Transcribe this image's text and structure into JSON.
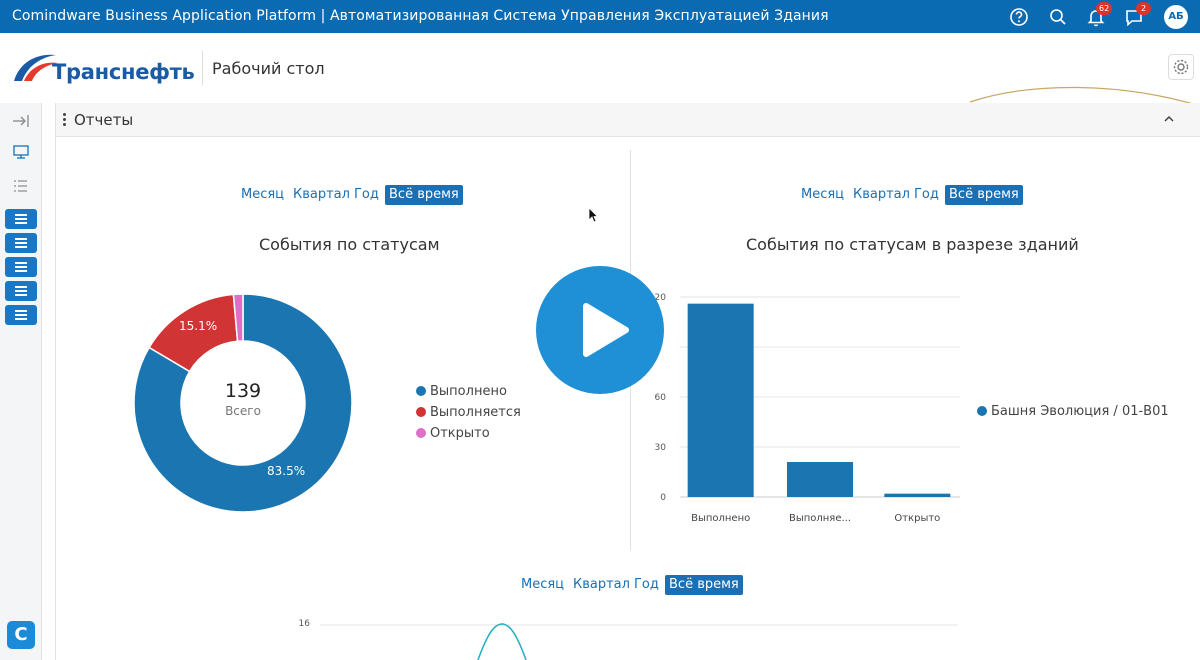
{
  "topbar": {
    "title": "Comindware Business Application Platform | Автоматизированная Система Управления Эксплуатацией Здания",
    "notifications_count": "62",
    "messages_count": "2",
    "avatar_initials": "АБ",
    "icons": [
      "help-icon",
      "search-icon",
      "bell-icon",
      "chat-icon"
    ]
  },
  "header": {
    "logo_text": "Транснефть",
    "page_title": "Рабочий стол"
  },
  "panel": {
    "title": "Отчеты"
  },
  "filters": {
    "left": [
      "Месяц",
      "Квартал",
      "Год",
      "Всё время"
    ],
    "right": [
      "Месяц",
      "Квартал",
      "Год",
      "Всё время"
    ],
    "bottom": [
      "Месяц",
      "Квартал",
      "Год",
      "Всё время"
    ],
    "active": "Всё время"
  },
  "colors": {
    "primary": "#1a6fb5",
    "done": "#1b75b0",
    "in_progress": "#d03434",
    "open": "#dd6fc7",
    "topbar": "#0a6bb3"
  },
  "chart_data": [
    {
      "type": "pie",
      "title": "События по статусам",
      "center_total": "139",
      "center_label": "Всего",
      "slices": [
        {
          "label": "Выполнено",
          "value": 83.5,
          "display": "83.5%"
        },
        {
          "label": "Выполняется",
          "value": 15.1,
          "display": "15.1%"
        },
        {
          "label": "Открыто",
          "value": 1.4,
          "display": ""
        }
      ]
    },
    {
      "type": "bar",
      "title": "События по статусам в разрезе зданий",
      "categories": [
        "Выполнено",
        "Выполняе...",
        "Открыто"
      ],
      "series": [
        {
          "name": "Башня Эволюция / 01-В01",
          "values": [
            116,
            21,
            2
          ]
        }
      ],
      "yticks": [
        "0",
        "30",
        "60",
        "",
        "120"
      ],
      "ylim": [
        0,
        120
      ]
    },
    {
      "type": "line",
      "ytick_top": "16"
    }
  ]
}
